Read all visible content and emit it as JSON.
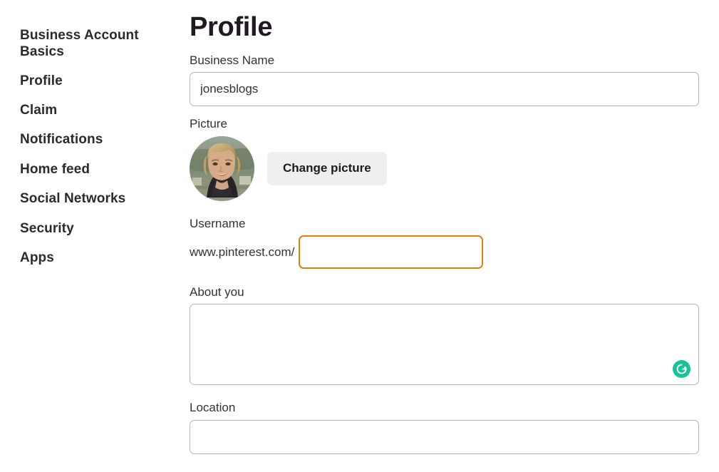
{
  "sidebar": {
    "items": [
      {
        "label": "Business Account Basics",
        "name": "sidebar-item-business-account-basics",
        "two_line": true
      },
      {
        "label": "Profile",
        "name": "sidebar-item-profile",
        "two_line": false
      },
      {
        "label": "Claim",
        "name": "sidebar-item-claim",
        "two_line": false
      },
      {
        "label": "Notifications",
        "name": "sidebar-item-notifications",
        "two_line": false
      },
      {
        "label": "Home feed",
        "name": "sidebar-item-home-feed",
        "two_line": false
      },
      {
        "label": "Social Networks",
        "name": "sidebar-item-social-networks",
        "two_line": false
      },
      {
        "label": "Security",
        "name": "sidebar-item-security",
        "two_line": false
      },
      {
        "label": "Apps",
        "name": "sidebar-item-apps",
        "two_line": false
      }
    ]
  },
  "main": {
    "title": "Profile",
    "business_name": {
      "label": "Business Name",
      "value": "jonesblogs",
      "placeholder": ""
    },
    "picture": {
      "label": "Picture",
      "change_button_label": "Change picture",
      "avatar_alt": "profile-photo"
    },
    "username": {
      "label": "Username",
      "prefix": "www.pinterest.com/",
      "value": "",
      "placeholder": "",
      "focus_border_color": "#e07b17"
    },
    "about": {
      "label": "About you",
      "value": "",
      "placeholder": ""
    },
    "location": {
      "label": "Location",
      "value": "",
      "placeholder": ""
    }
  },
  "overlays": {
    "grammarly": {
      "icon_name": "grammarly-icon",
      "color": "#15c39a"
    }
  }
}
